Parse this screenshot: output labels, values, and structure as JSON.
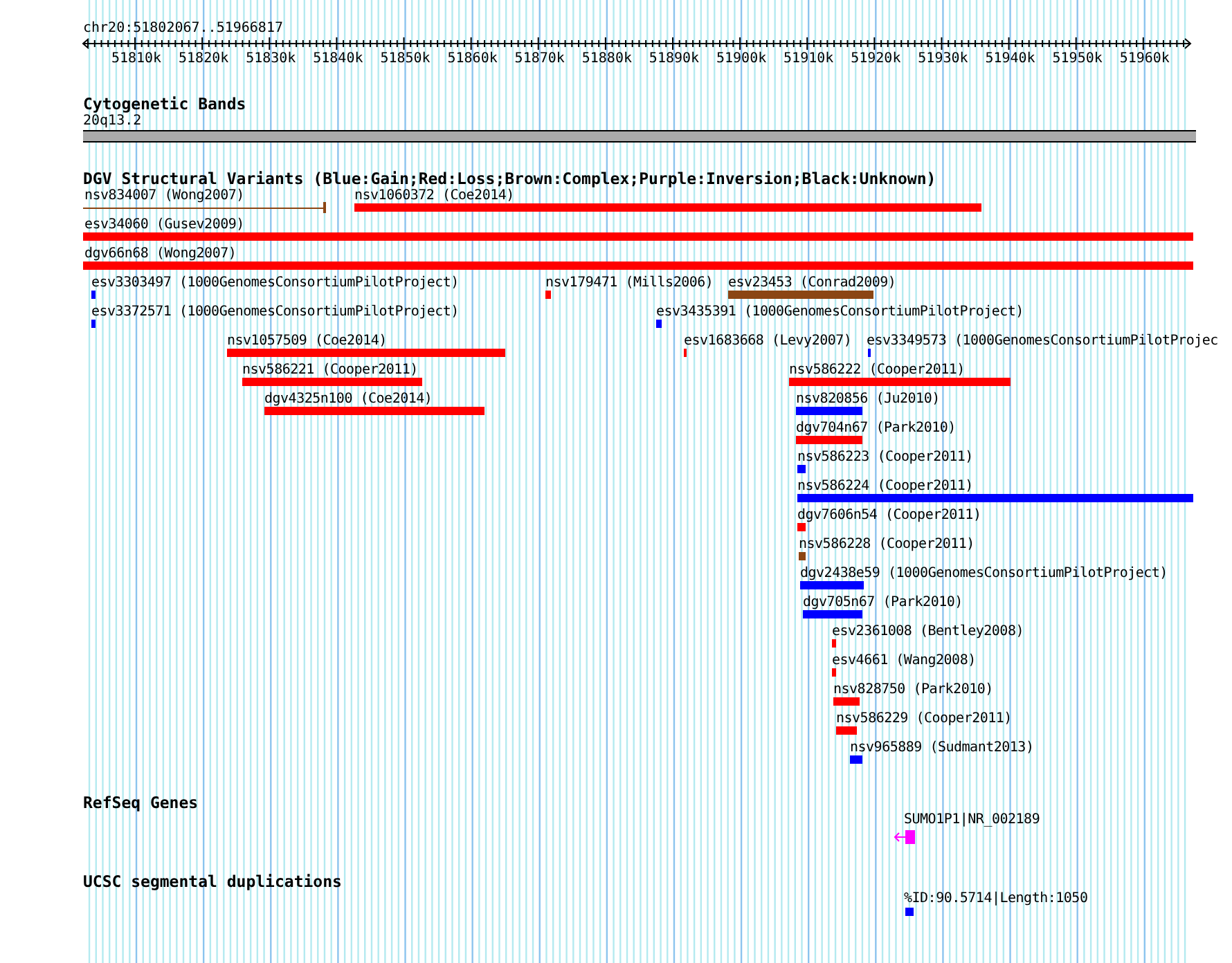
{
  "ruler": {
    "range": "chr20:51802067..51966817",
    "tick_labels": [
      "51810k",
      "51820k",
      "51830k",
      "51840k",
      "51850k",
      "51860k",
      "51870k",
      "51880k",
      "51890k",
      "51900k",
      "51910k",
      "51920k",
      "51930k",
      "51940k",
      "51950k",
      "51960k"
    ]
  },
  "cytogenetic_bands": {
    "title": "Cytogenetic Bands",
    "band": "20q13.2"
  },
  "dgv": {
    "title": "DGV Structural Variants (Blue:Gain;Red:Loss;Brown:Complex;Purple:Inversion;Black:Unknown)",
    "rows": [
      {
        "features": [
          {
            "label": "nsv834007 (Wong2007)",
            "kind": "line",
            "color": "#8b4513"
          },
          {
            "label": "nsv1060372 (Coe2014)",
            "kind": "bar",
            "color": "#ff0000"
          }
        ]
      },
      {
        "features": [
          {
            "label": "esv34060 (Gusev2009)",
            "kind": "bar",
            "color": "#ff0000"
          }
        ]
      },
      {
        "features": [
          {
            "label": "dgv66n68 (Wong2007)",
            "kind": "bar",
            "color": "#ff0000"
          }
        ]
      },
      {
        "features": [
          {
            "label": "esv3303497 (1000GenomesConsortiumPilotProject)",
            "kind": "bar",
            "color": "#0000ff"
          },
          {
            "label": "nsv179471 (Mills2006)",
            "kind": "bar",
            "color": "#ff0000"
          },
          {
            "label": "esv23453 (Conrad2009)",
            "kind": "bar",
            "color": "#8b4513"
          }
        ]
      },
      {
        "features": [
          {
            "label": "esv3372571 (1000GenomesConsortiumPilotProject)",
            "kind": "bar",
            "color": "#0000ff"
          },
          {
            "label": "esv3435391 (1000GenomesConsortiumPilotProject)",
            "kind": "bar",
            "color": "#0000ff"
          }
        ]
      },
      {
        "features": [
          {
            "label": "nsv1057509 (Coe2014)",
            "kind": "bar",
            "color": "#ff0000"
          },
          {
            "label": "esv1683668 (Levy2007)",
            "kind": "bar",
            "color": "#ff0000"
          },
          {
            "label": "esv3349573 (1000GenomesConsortiumPilotProjec",
            "kind": "bar",
            "color": "#0000ff"
          }
        ]
      },
      {
        "features": [
          {
            "label": "nsv586221 (Cooper2011)",
            "kind": "bar",
            "color": "#ff0000"
          },
          {
            "label": "nsv586222 (Cooper2011)",
            "kind": "bar",
            "color": "#ff0000"
          }
        ]
      },
      {
        "features": [
          {
            "label": "dgv4325n100 (Coe2014)",
            "kind": "bar",
            "color": "#ff0000"
          },
          {
            "label": "nsv820856 (Ju2010)",
            "kind": "bar",
            "color": "#0000ff"
          }
        ]
      },
      {
        "features": [
          {
            "label": "dgv704n67 (Park2010)",
            "kind": "bar",
            "color": "#ff0000"
          }
        ]
      },
      {
        "features": [
          {
            "label": "nsv586223 (Cooper2011)",
            "kind": "bar",
            "color": "#0000ff"
          }
        ]
      },
      {
        "features": [
          {
            "label": "nsv586224 (Cooper2011)",
            "kind": "bar",
            "color": "#0000ff"
          }
        ]
      },
      {
        "features": [
          {
            "label": "dgv7606n54 (Cooper2011)",
            "kind": "bar",
            "color": "#ff0000"
          }
        ]
      },
      {
        "features": [
          {
            "label": "nsv586228 (Cooper2011)",
            "kind": "bar",
            "color": "#8b4513"
          }
        ]
      },
      {
        "features": [
          {
            "label": "dgv2438e59 (1000GenomesConsortiumPilotProject)",
            "kind": "bar",
            "color": "#0000ff"
          }
        ]
      },
      {
        "features": [
          {
            "label": "dgv705n67 (Park2010)",
            "kind": "bar",
            "color": "#0000ff"
          }
        ]
      },
      {
        "features": [
          {
            "label": "esv2361008 (Bentley2008)",
            "kind": "bar",
            "color": "#ff0000"
          }
        ]
      },
      {
        "features": [
          {
            "label": "esv4661 (Wang2008)",
            "kind": "bar",
            "color": "#ff0000"
          }
        ]
      },
      {
        "features": [
          {
            "label": "nsv828750 (Park2010)",
            "kind": "bar",
            "color": "#ff0000"
          }
        ]
      },
      {
        "features": [
          {
            "label": "nsv586229 (Cooper2011)",
            "kind": "bar",
            "color": "#ff0000"
          }
        ]
      },
      {
        "features": [
          {
            "label": "nsv965889 (Sudmant2013)",
            "kind": "bar",
            "color": "#0000ff"
          }
        ]
      }
    ]
  },
  "refseq_genes": {
    "title": "RefSeq Genes",
    "gene": {
      "label": "SUMO1P1|NR_002189"
    }
  },
  "segmental_duplications": {
    "title": "UCSC segmental duplications",
    "item": {
      "label": "%ID:90.5714|Length:1050"
    }
  }
}
